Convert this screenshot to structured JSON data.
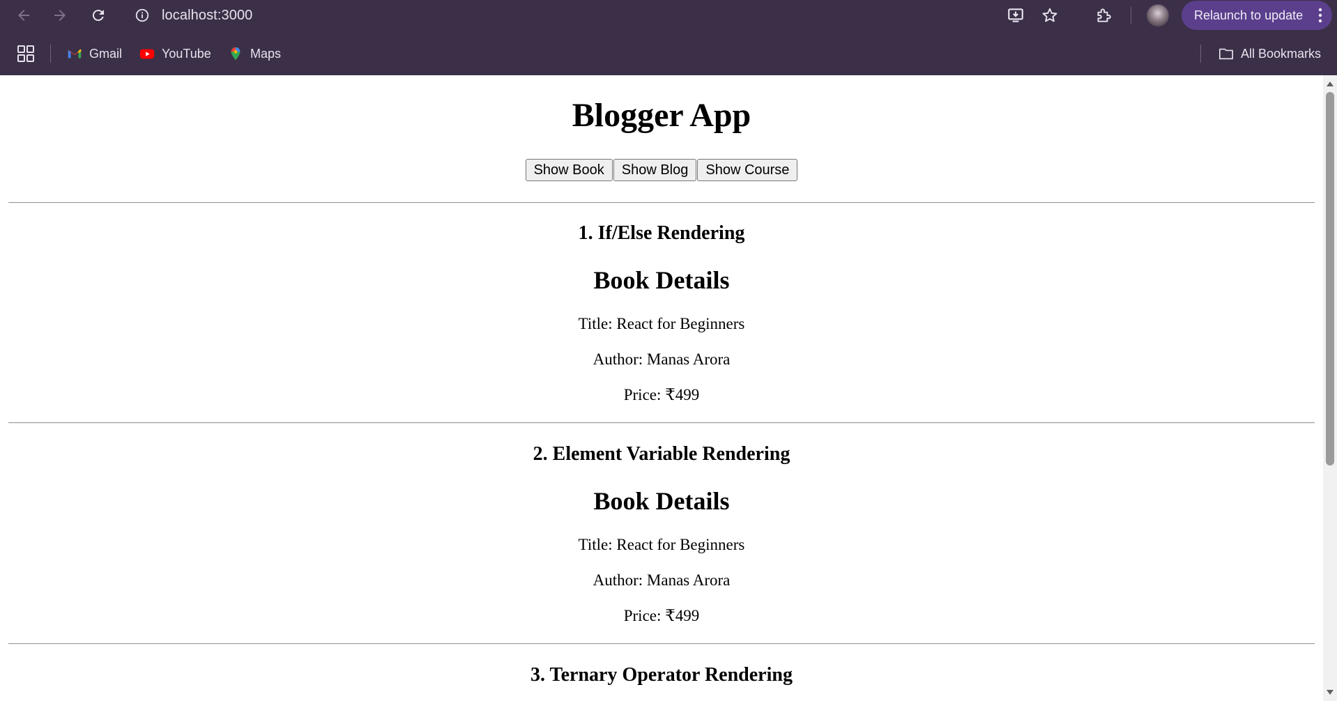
{
  "browser": {
    "url": "localhost:3000",
    "relaunch_label": "Relaunch to update",
    "bookmarks": [
      {
        "label": "Gmail",
        "icon": "gmail-icon"
      },
      {
        "label": "YouTube",
        "icon": "youtube-icon"
      },
      {
        "label": "Maps",
        "icon": "maps-icon"
      }
    ],
    "all_bookmarks_label": "All Bookmarks",
    "accent_color": "#5b3f8c"
  },
  "app": {
    "title": "Blogger App",
    "buttons": [
      "Show Book",
      "Show Blog",
      "Show Course"
    ]
  },
  "sections": [
    {
      "heading": "1. If/Else Rendering",
      "details_title": "Book Details",
      "lines": [
        "Title: React for Beginners",
        "Author: Manas Arora",
        "Price: ₹499"
      ]
    },
    {
      "heading": "2. Element Variable Rendering",
      "details_title": "Book Details",
      "lines": [
        "Title: React for Beginners",
        "Author: Manas Arora",
        "Price: ₹499"
      ]
    },
    {
      "heading": "3. Ternary Operator Rendering"
    }
  ]
}
